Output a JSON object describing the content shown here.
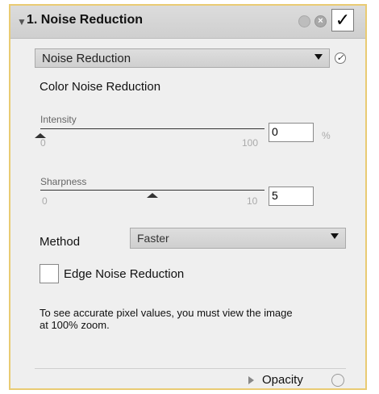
{
  "panel": {
    "title": "1. Noise Reduction",
    "enabled_mark": "✓",
    "close_glyph": "×"
  },
  "mode_select": {
    "value": "Noise Reduction",
    "check_glyph": "✓"
  },
  "section_title": "Color Noise Reduction",
  "intensity": {
    "label": "Intensity",
    "min": "0",
    "max": "100",
    "value": "0",
    "unit": "%",
    "level": 0
  },
  "sharpness": {
    "label": "Sharpness",
    "min": "0",
    "max": "10",
    "value": "5",
    "level": 0.5
  },
  "method": {
    "label": "Method",
    "value": "Faster"
  },
  "edge": {
    "label": "Edge Noise Reduction",
    "checked": false
  },
  "info_text": "To see accurate pixel values, you must view the image at 100% zoom.",
  "footer": {
    "opacity_label": "Opacity"
  }
}
